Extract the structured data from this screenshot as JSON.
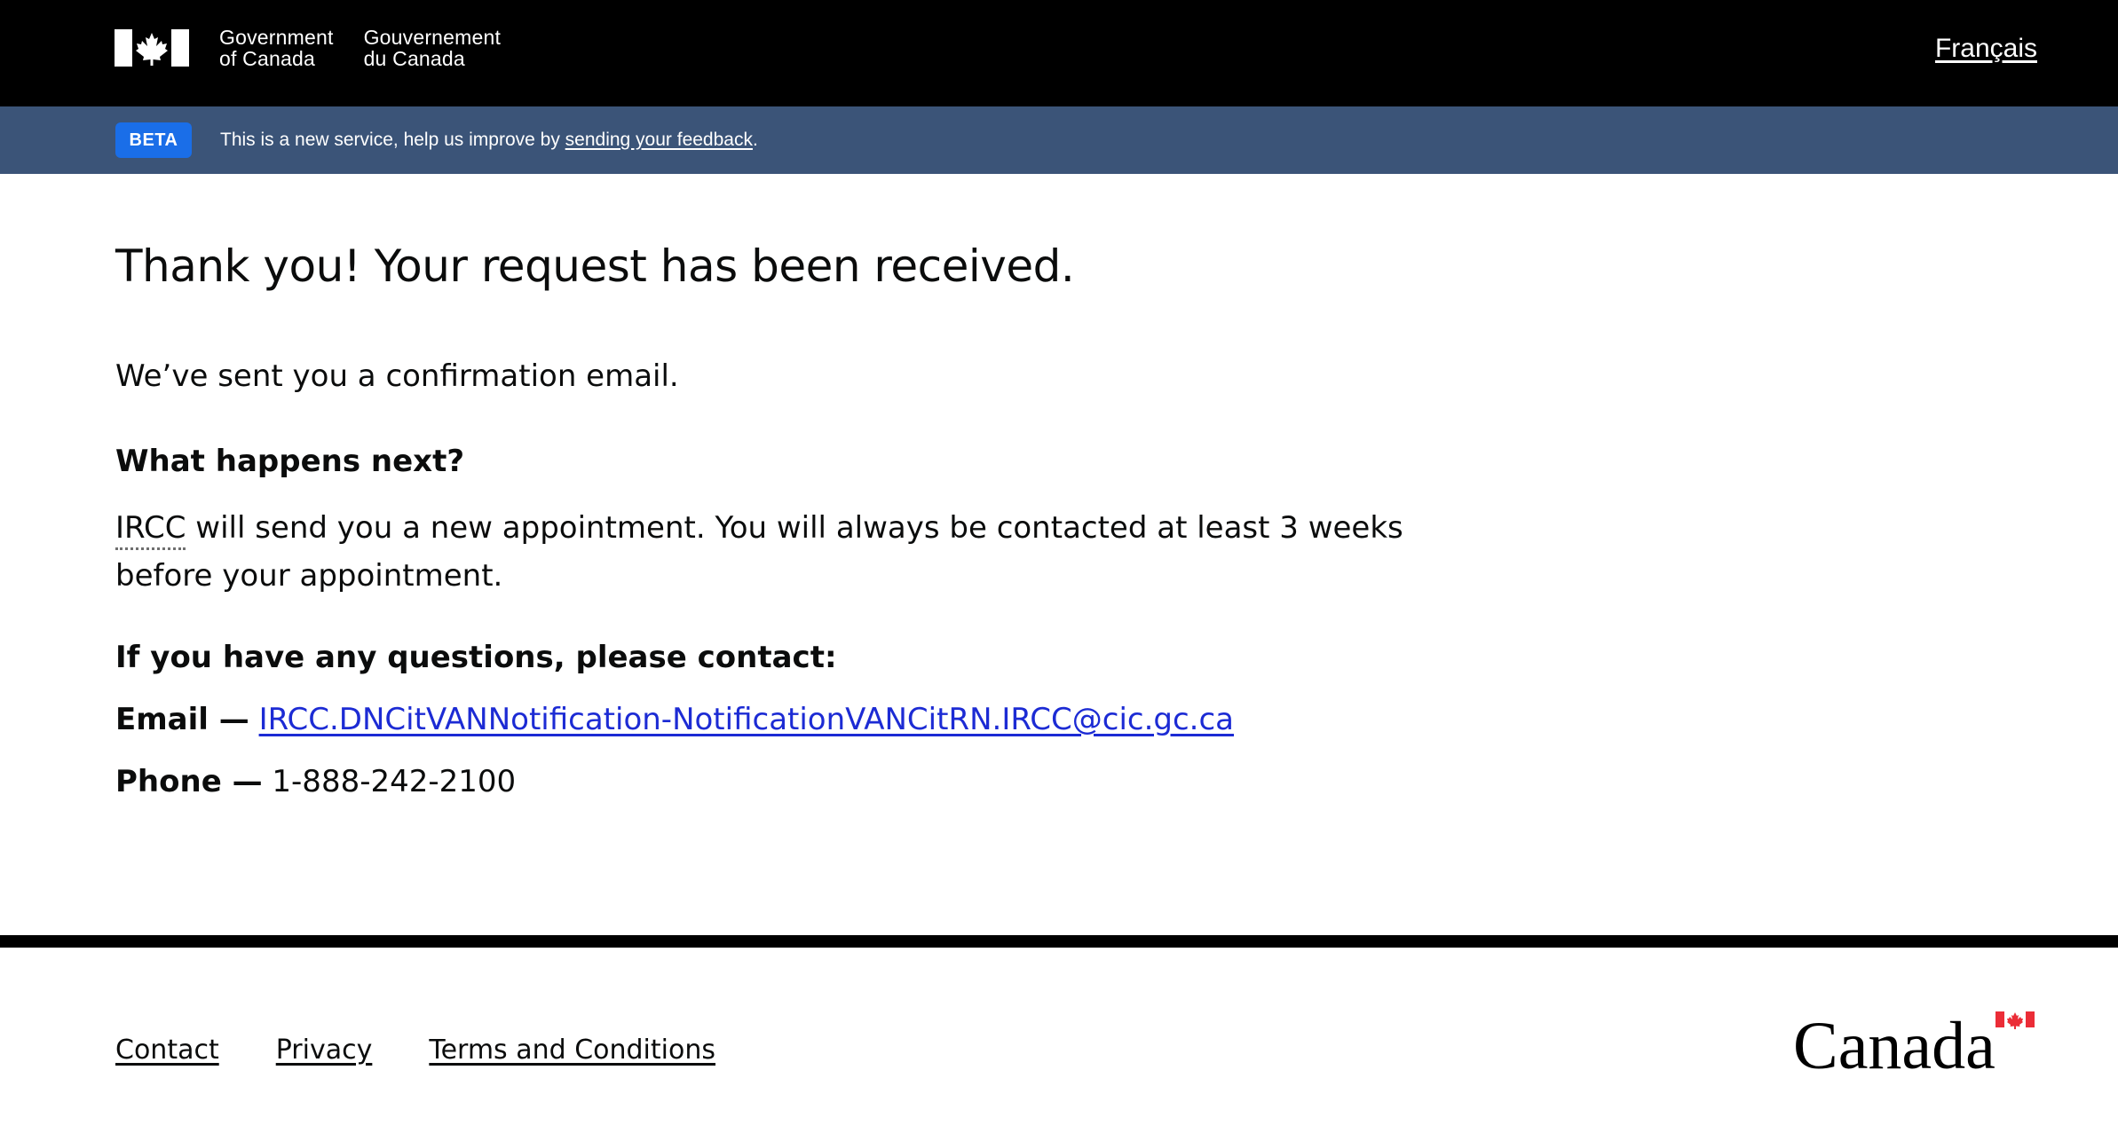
{
  "header": {
    "gov_en_line1": "Government",
    "gov_en_line2": "of Canada",
    "gov_fr_line1": "Gouvernement",
    "gov_fr_line2": "du Canada",
    "language_link": "Français"
  },
  "beta_banner": {
    "badge": "BETA",
    "text_before": "This is a new service, help us improve by ",
    "feedback_link": "sending your feedback",
    "text_after": "."
  },
  "main": {
    "title": "Thank you! Your request has been received.",
    "confirmation": "We’ve sent you a confirmation email.",
    "next_heading": "What happens next?",
    "next_abbr": "IRCC",
    "next_text": " will send you a new appointment. You will always be contacted at least 3 weeks before your appointment.",
    "questions_heading": "If you have any questions, please contact:",
    "email_label": "Email —",
    "email_value": "IRCC.DNCitVANNotification-NotificationVANCitRN.IRCC@cic.gc.ca",
    "phone_label": "Phone —",
    "phone_value": "1-888-242-2100"
  },
  "footer": {
    "links": [
      "Contact",
      "Privacy",
      "Terms and Conditions"
    ],
    "wordmark": "Canada"
  },
  "colors": {
    "header_bg": "#000000",
    "banner_bg": "#3b5478",
    "beta_badge": "#1a6ee8",
    "link": "#1c2bd4",
    "flag_red": "#eb2d37"
  }
}
